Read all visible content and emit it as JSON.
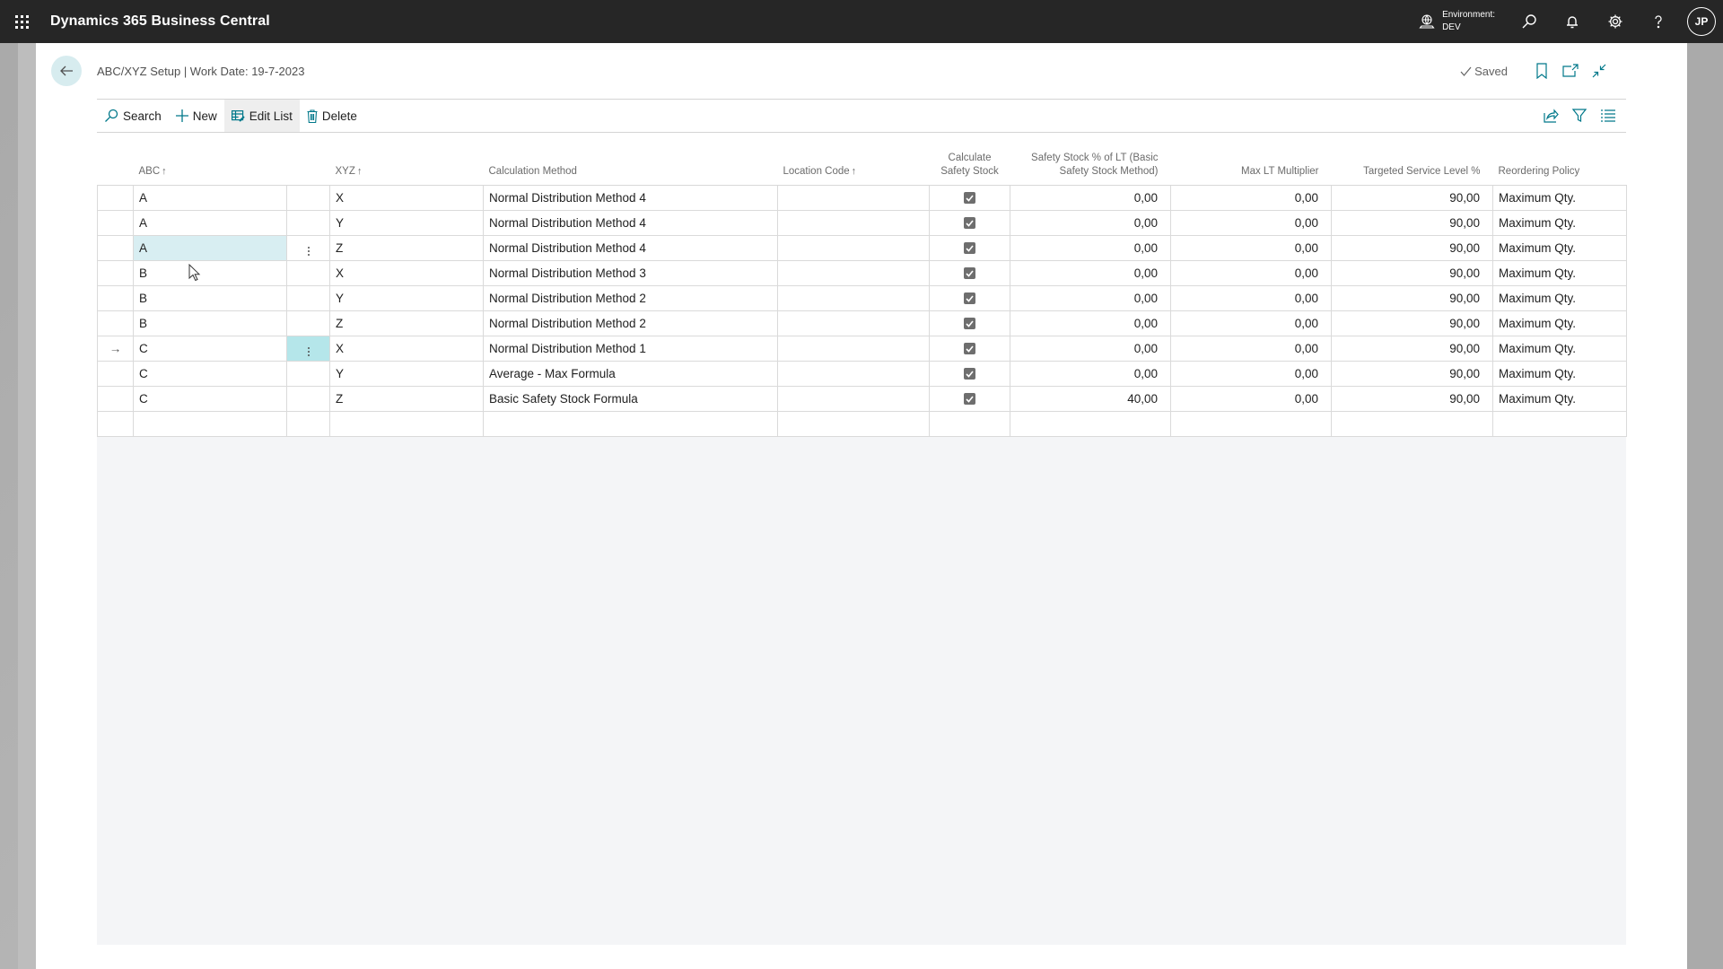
{
  "appbar": {
    "title": "Dynamics 365 Business Central",
    "environment_label": "Environment:",
    "environment_value": "DEV",
    "user_initials": "JP"
  },
  "page": {
    "title": "ABC/XYZ Setup | Work Date: 19-7-2023",
    "status": "Saved"
  },
  "actions": {
    "search": "Search",
    "new": "New",
    "edit_list": "Edit List",
    "delete": "Delete"
  },
  "columns": {
    "abc": "ABC",
    "xyz": "XYZ",
    "calc_method": "Calculation Method",
    "location_code": "Location Code",
    "calc_safety_stock_1": "Calculate",
    "calc_safety_stock_2": "Safety Stock",
    "safety_pct_1": "Safety Stock % of LT (Basic",
    "safety_pct_2": "Safety Stock Method)",
    "max_lt": "Max LT Multiplier",
    "service_level": "Targeted Service Level %",
    "reorder_policy": "Reordering Policy",
    "sort_arrow": "↑"
  },
  "rows": [
    {
      "abc": "A",
      "xyz": "X",
      "method": "Normal Distribution Method 4",
      "location": "",
      "calc_ss": true,
      "ss_pct": "0,00",
      "max_lt": "0,00",
      "service": "90,00",
      "policy": "Maximum Qty."
    },
    {
      "abc": "A",
      "xyz": "Y",
      "method": "Normal Distribution Method 4",
      "location": "",
      "calc_ss": true,
      "ss_pct": "0,00",
      "max_lt": "0,00",
      "service": "90,00",
      "policy": "Maximum Qty."
    },
    {
      "abc": "A",
      "xyz": "Z",
      "method": "Normal Distribution Method 4",
      "location": "",
      "calc_ss": true,
      "ss_pct": "0,00",
      "max_lt": "0,00",
      "service": "90,00",
      "policy": "Maximum Qty."
    },
    {
      "abc": "B",
      "xyz": "X",
      "method": "Normal Distribution Method 3",
      "location": "",
      "calc_ss": true,
      "ss_pct": "0,00",
      "max_lt": "0,00",
      "service": "90,00",
      "policy": "Maximum Qty."
    },
    {
      "abc": "B",
      "xyz": "Y",
      "method": "Normal Distribution Method 2",
      "location": "",
      "calc_ss": true,
      "ss_pct": "0,00",
      "max_lt": "0,00",
      "service": "90,00",
      "policy": "Maximum Qty."
    },
    {
      "abc": "B",
      "xyz": "Z",
      "method": "Normal Distribution Method 2",
      "location": "",
      "calc_ss": true,
      "ss_pct": "0,00",
      "max_lt": "0,00",
      "service": "90,00",
      "policy": "Maximum Qty."
    },
    {
      "abc": "C",
      "xyz": "X",
      "method": "Normal Distribution Method 1",
      "location": "",
      "calc_ss": true,
      "ss_pct": "0,00",
      "max_lt": "0,00",
      "service": "90,00",
      "policy": "Maximum Qty."
    },
    {
      "abc": "C",
      "xyz": "Y",
      "method": "Average - Max Formula",
      "location": "",
      "calc_ss": true,
      "ss_pct": "0,00",
      "max_lt": "0,00",
      "service": "90,00",
      "policy": "Maximum Qty."
    },
    {
      "abc": "C",
      "xyz": "Z",
      "method": "Basic Safety Stock Formula",
      "location": "",
      "calc_ss": true,
      "ss_pct": "40,00",
      "max_lt": "0,00",
      "service": "90,00",
      "policy": "Maximum Qty."
    }
  ],
  "current_row_indicator": "→",
  "colors": {
    "accent": "#00788a",
    "appbar": "#262626",
    "selection": "#d8eef2"
  }
}
